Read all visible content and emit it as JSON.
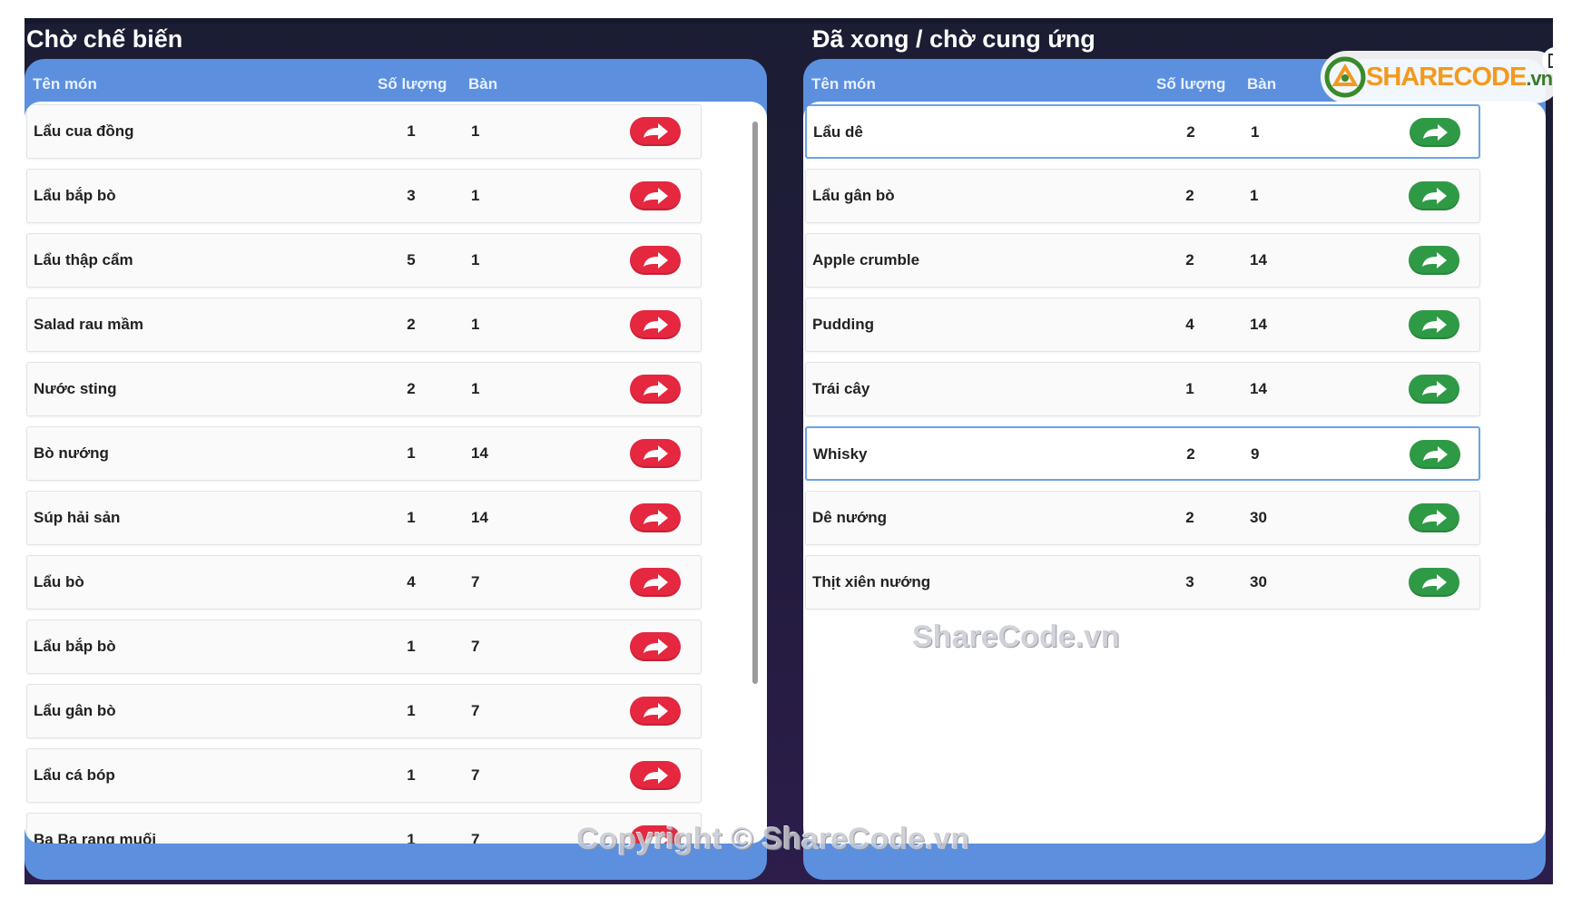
{
  "pending": {
    "title": "Chờ chế biến",
    "columns": {
      "name": "Tên món",
      "qty": "Số lượng",
      "table": "Bàn"
    },
    "rows": [
      {
        "name": "Lẩu cua đồng",
        "qty": "1",
        "table": "1"
      },
      {
        "name": "Lẩu bắp bò",
        "qty": "3",
        "table": "1"
      },
      {
        "name": "Lẩu thập cẩm",
        "qty": "5",
        "table": "1"
      },
      {
        "name": "Salad rau mầm",
        "qty": "2",
        "table": "1"
      },
      {
        "name": "Nước sting",
        "qty": "2",
        "table": "1"
      },
      {
        "name": "Bò nướng",
        "qty": "1",
        "table": "14"
      },
      {
        "name": "Súp hải sản",
        "qty": "1",
        "table": "14"
      },
      {
        "name": "Lẩu bò",
        "qty": "4",
        "table": "7"
      },
      {
        "name": "Lẩu bắp bò",
        "qty": "1",
        "table": "7"
      },
      {
        "name": "Lẩu gân bò",
        "qty": "1",
        "table": "7"
      },
      {
        "name": "Lẩu cá bóp",
        "qty": "1",
        "table": "7"
      },
      {
        "name": "Ba Ba rang muối",
        "qty": "1",
        "table": "7"
      }
    ],
    "button_color": "#e5273f"
  },
  "done": {
    "title": "Đã xong / chờ cung ứng",
    "columns": {
      "name": "Tên món",
      "qty": "Số lượng",
      "table": "Bàn"
    },
    "rows": [
      {
        "name": "Lẩu dê",
        "qty": "2",
        "table": "1",
        "selected": true
      },
      {
        "name": "Lẩu gân bò",
        "qty": "2",
        "table": "1"
      },
      {
        "name": "Apple crumble",
        "qty": "2",
        "table": "14"
      },
      {
        "name": "Pudding",
        "qty": "4",
        "table": "14"
      },
      {
        "name": "Trái cây",
        "qty": "1",
        "table": "14"
      },
      {
        "name": "Whisky",
        "qty": "2",
        "table": "9",
        "selected": true
      },
      {
        "name": "Dê nướng",
        "qty": "2",
        "table": "30"
      },
      {
        "name": "Thịt xiên nướng",
        "qty": "3",
        "table": "30"
      }
    ],
    "button_color": "#2f9a46"
  },
  "watermarks": {
    "middle": "ShareCode.vn",
    "copyright": "Copyright © ShareCode.vn",
    "logo": "SHARECODE",
    "logo_suffix": ".vn"
  },
  "icons": {
    "row_action": "forward-arrow-icon",
    "exit": "exit-icon"
  },
  "colors": {
    "panel": "#5c90df",
    "background": "#1b1d33"
  }
}
